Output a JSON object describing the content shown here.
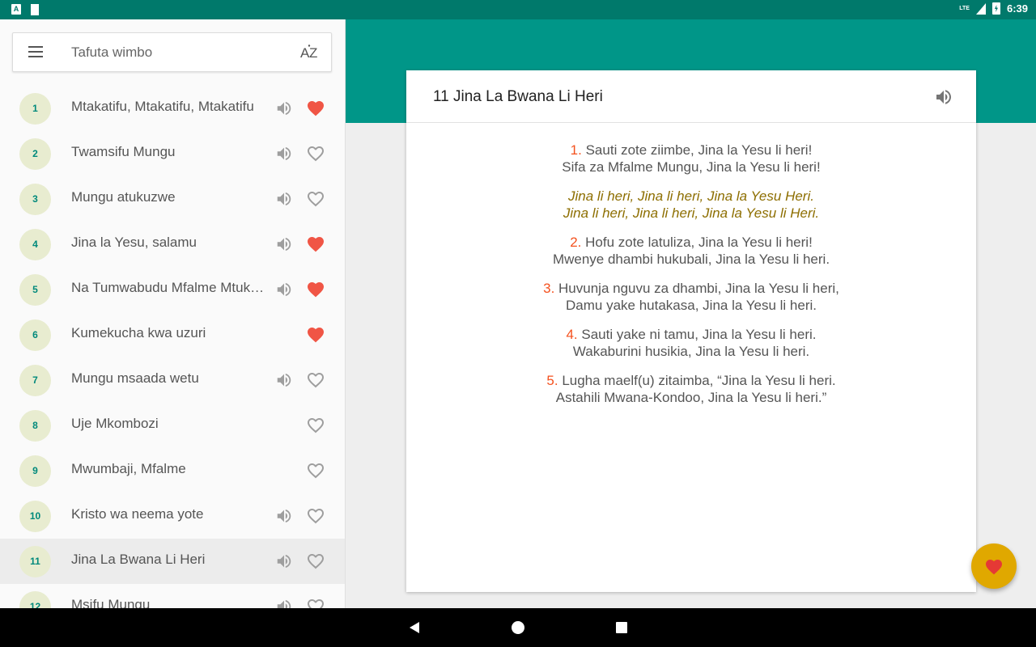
{
  "status_bar": {
    "time": "6:39",
    "network": "LTE"
  },
  "search": {
    "placeholder": "Tafuta wimbo",
    "sort_label": "AZ"
  },
  "songs": [
    {
      "number": "1",
      "title": "Mtakatifu, Mtakatifu, Mtakatifu",
      "audio": true,
      "favorite": true
    },
    {
      "number": "2",
      "title": "Twamsifu Mungu",
      "audio": true,
      "favorite": false
    },
    {
      "number": "3",
      "title": "Mungu atukuzwe",
      "audio": true,
      "favorite": false
    },
    {
      "number": "4",
      "title": "Jina la Yesu, salamu",
      "audio": true,
      "favorite": true
    },
    {
      "number": "5",
      "title": "Na Tumwabudu Mfalme Mtukufu",
      "audio": true,
      "favorite": true
    },
    {
      "number": "6",
      "title": "Kumekucha kwa uzuri",
      "audio": false,
      "favorite": true
    },
    {
      "number": "7",
      "title": "Mungu msaada wetu",
      "audio": true,
      "favorite": false
    },
    {
      "number": "8",
      "title": "Uje Mkombozi",
      "audio": false,
      "favorite": false
    },
    {
      "number": "9",
      "title": "Mwumbaji, Mfalme",
      "audio": false,
      "favorite": false
    },
    {
      "number": "10",
      "title": "Kristo wa neema yote",
      "audio": true,
      "favorite": false
    },
    {
      "number": "11",
      "title": "Jina La Bwana Li Heri",
      "audio": true,
      "favorite": false,
      "selected": true
    },
    {
      "number": "12",
      "title": "Msifu Mungu",
      "audio": true,
      "favorite": false
    }
  ],
  "hymn": {
    "title": "11 Jina La Bwana Li Heri",
    "stanzas": [
      {
        "num": "1.",
        "lines": [
          "Sauti zote ziimbe, Jina la Yesu li heri!",
          "Sifa za Mfalme Mungu, Jina la Yesu li heri!"
        ]
      },
      {
        "chorus": true,
        "lines": [
          "Jina li heri, Jina li heri, Jina la Yesu Heri.",
          "Jina li heri, Jina li heri, Jina la Yesu li Heri."
        ]
      },
      {
        "num": "2.",
        "lines": [
          "Hofu zote latuliza, Jina la Yesu li heri!",
          "Mwenye dhambi hukubali, Jina la Yesu li heri."
        ]
      },
      {
        "num": "3.",
        "lines": [
          "Huvunja nguvu za dhambi, Jina la Yesu li heri,",
          "Damu yake hutakasa, Jina la Yesu li heri."
        ]
      },
      {
        "num": "4.",
        "lines": [
          "Sauti yake ni tamu, Jina la Yesu li heri.",
          "Wakaburini husikia, Jina la Yesu li heri."
        ]
      },
      {
        "num": "5.",
        "lines": [
          "Lugha maelf(u) zitaimba, “Jina la Yesu li heri.",
          "Astahili Mwana-Kondoo, Jina la Yesu li heri.”"
        ]
      }
    ]
  },
  "colors": {
    "primary": "#009688",
    "status_bar": "#00796b",
    "accent": "#e0a800",
    "heart_red": "#f05545",
    "stanza_number": "#f4511e",
    "chorus_text": "#8d6e00"
  }
}
